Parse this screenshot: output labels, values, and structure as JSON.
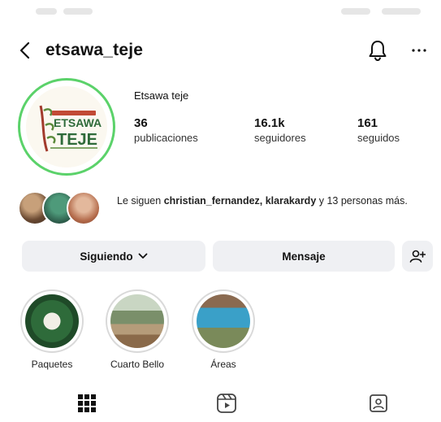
{
  "header": {
    "username": "etsawa_teje",
    "back_icon": "chevron-left-icon",
    "notifications_icon": "bell-icon",
    "more_icon": "more-horizontal-icon"
  },
  "profile": {
    "display_name": "Etsawa teje",
    "avatar_logo_text": "ETSAWA TEJE",
    "stats": [
      {
        "value": "36",
        "label": "publicaciones"
      },
      {
        "value": "16.1k",
        "label": "seguidores"
      },
      {
        "value": "161",
        "label": "seguidos"
      }
    ],
    "ring_color": "#5bd26a"
  },
  "followed_by": {
    "prefix": "Le siguen ",
    "names": "christian_fernandez, klarakardy",
    "suffix": " y 13 personas más."
  },
  "actions": {
    "following_label": "Siguiendo",
    "message_label": "Mensaje",
    "add_person_icon": "add-person-icon"
  },
  "highlights": [
    {
      "label": "Paquetes"
    },
    {
      "label": "Cuarto Bello"
    },
    {
      "label": "Áreas"
    }
  ],
  "tabs": [
    {
      "icon": "grid-icon"
    },
    {
      "icon": "reels-icon"
    },
    {
      "icon": "tagged-icon"
    }
  ]
}
